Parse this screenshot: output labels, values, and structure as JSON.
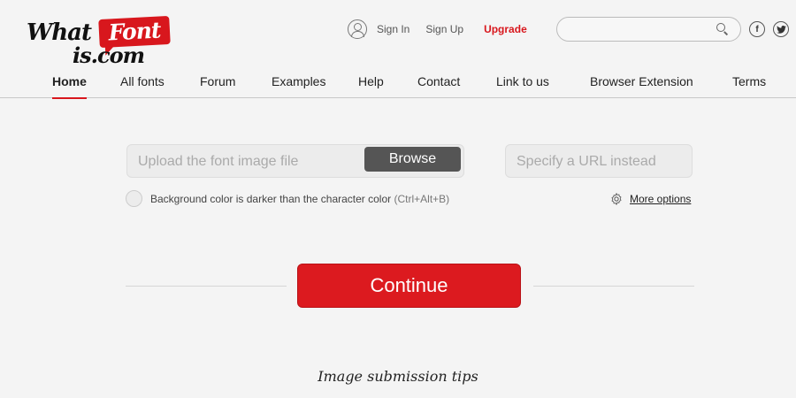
{
  "logo": {
    "part1": "What",
    "part2": "Font",
    "part3": "is.com"
  },
  "header": {
    "sign_in": "Sign In",
    "sign_up": "Sign Up",
    "upgrade": "Upgrade",
    "search_placeholder": "",
    "facebook_glyph": "f",
    "twitter_glyph": "🐦"
  },
  "nav": {
    "items": [
      {
        "label": "Home",
        "active": true
      },
      {
        "label": "All fonts"
      },
      {
        "label": "Forum"
      },
      {
        "label": "Examples"
      },
      {
        "label": "Help"
      },
      {
        "label": "Contact"
      },
      {
        "label": "Link to us"
      },
      {
        "label": "Browser Extension"
      },
      {
        "label": "Terms"
      }
    ]
  },
  "upload": {
    "placeholder": "Upload the font image file",
    "browse_label": "Browse",
    "url_placeholder": "Specify a URL instead"
  },
  "options": {
    "checkbox_label": "Background color is darker than the character color",
    "checkbox_shortcut": "(Ctrl+Alt+B)",
    "more_options": "More options"
  },
  "actions": {
    "continue_label": "Continue"
  },
  "footer": {
    "tips_heading": "Image submission tips"
  },
  "colors": {
    "accent": "#d8171d",
    "background": "#f4f4f4"
  }
}
